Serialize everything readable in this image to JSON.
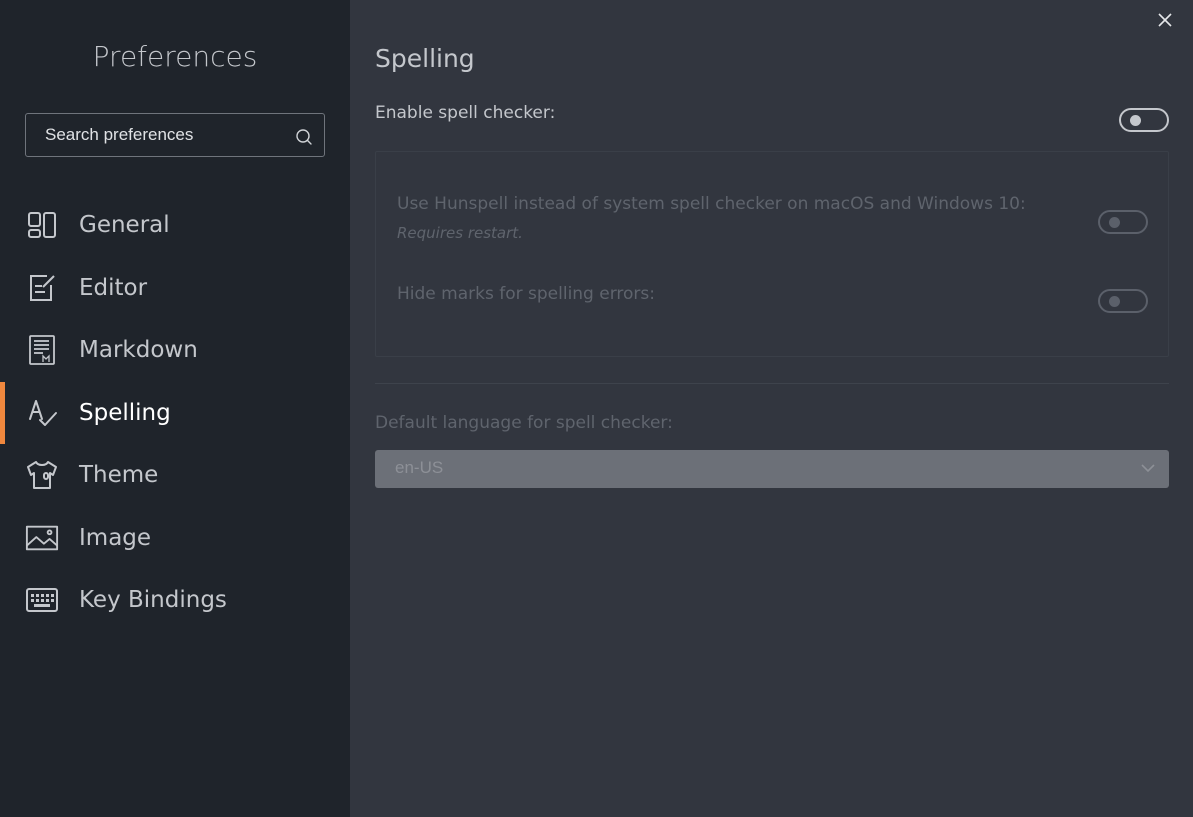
{
  "sidebar": {
    "title": "Preferences",
    "search": {
      "placeholder": "Search preferences",
      "value": ""
    },
    "items": [
      {
        "label": "General",
        "icon": "general-icon",
        "active": false
      },
      {
        "label": "Editor",
        "icon": "editor-icon",
        "active": false
      },
      {
        "label": "Markdown",
        "icon": "markdown-icon",
        "active": false
      },
      {
        "label": "Spelling",
        "icon": "spelling-icon",
        "active": true
      },
      {
        "label": "Theme",
        "icon": "theme-icon",
        "active": false
      },
      {
        "label": "Image",
        "icon": "image-icon",
        "active": false
      },
      {
        "label": "Key Bindings",
        "icon": "keyboard-icon",
        "active": false
      }
    ]
  },
  "main": {
    "title": "Spelling",
    "enable_spell_checker": {
      "label": "Enable spell checker:",
      "enabled": false
    },
    "use_hunspell": {
      "label": "Use Hunspell instead of system spell checker on macOS and Windows 10:",
      "note": "Requires restart.",
      "enabled": false,
      "disabled": true
    },
    "hide_marks": {
      "label": "Hide marks for spelling errors:",
      "enabled": false,
      "disabled": true
    },
    "default_language": {
      "label": "Default language for spell checker:",
      "value": "en-US",
      "disabled": true
    }
  },
  "colors": {
    "sidebar_bg": "#1f242b",
    "main_bg": "#32363f",
    "accent": "#f0883e"
  }
}
